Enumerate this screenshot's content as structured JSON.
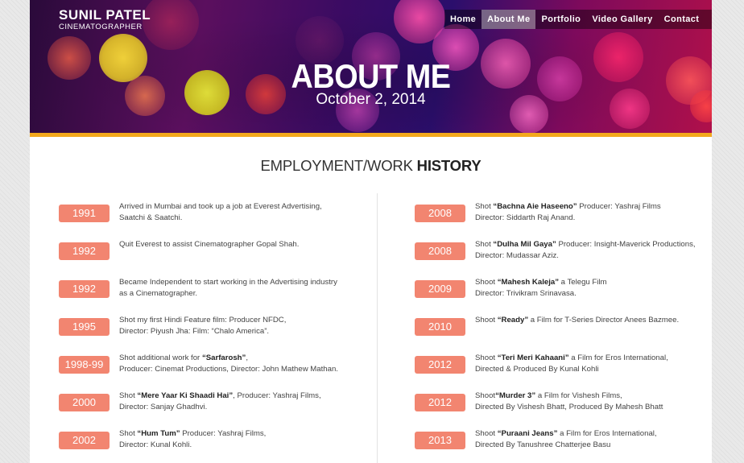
{
  "brand": {
    "name": "SUNIL PATEL",
    "subtitle": "CINEMATOGRAPHER"
  },
  "nav": {
    "items": [
      {
        "label": "Home",
        "active": false
      },
      {
        "label": "About Me",
        "active": true
      },
      {
        "label": "Portfolio",
        "active": false
      },
      {
        "label": "Video Gallery",
        "active": false
      },
      {
        "label": "Contact",
        "active": false
      }
    ]
  },
  "hero": {
    "title": "ABOUT ME",
    "date": "October 2, 2014"
  },
  "colors": {
    "accent_bar": "#f3a81c",
    "year_badge": "#f28570"
  },
  "section": {
    "title_light": "EMPLOYMENT/WORK ",
    "title_bold": "HISTORY"
  },
  "history_left": [
    {
      "year": "1991",
      "lines": [
        [
          {
            "t": "Arrived in Mumbai and took up a job at Everest Advertising,"
          }
        ],
        [
          {
            "t": "Saatchi & Saatchi."
          }
        ]
      ]
    },
    {
      "year": "1992",
      "lines": [
        [
          {
            "t": "Quit Everest to assist Cinematographer Gopal Shah."
          }
        ]
      ]
    },
    {
      "year": "1992",
      "lines": [
        [
          {
            "t": "Became Independent to start working in the Advertising industry"
          }
        ],
        [
          {
            "t": "as a Cinematographer."
          }
        ]
      ]
    },
    {
      "year": "1995",
      "lines": [
        [
          {
            "t": "Shot my first Hindi Feature film: Producer NFDC,"
          }
        ],
        [
          {
            "t": "Director: Piyush Jha: Film: “Chalo America”."
          }
        ]
      ]
    },
    {
      "year": "1998-99",
      "lines": [
        [
          {
            "t": "Shot additional work for "
          },
          {
            "t": "“Sarfarosh”",
            "b": true
          },
          {
            "t": ","
          }
        ],
        [
          {
            "t": "Producer: Cinemat Productions, Director: John Mathew Mathan."
          }
        ]
      ]
    },
    {
      "year": "2000",
      "lines": [
        [
          {
            "t": "Shot "
          },
          {
            "t": "“Mere Yaar Ki Shaadi Hai”",
            "b": true
          },
          {
            "t": ", Producer: Yashraj Films,"
          }
        ],
        [
          {
            "t": "Director: Sanjay Ghadhvi."
          }
        ]
      ]
    },
    {
      "year": "2002",
      "lines": [
        [
          {
            "t": "Shot "
          },
          {
            "t": "“Hum Tum”",
            "b": true
          },
          {
            "t": " Producer: Yashraj Films,"
          }
        ],
        [
          {
            "t": "Director: Kunal Kohli."
          }
        ]
      ]
    }
  ],
  "history_right": [
    {
      "year": "2008",
      "lines": [
        [
          {
            "t": "Shot "
          },
          {
            "t": "“Bachna Aie Haseeno”",
            "b": true
          },
          {
            "t": " Producer: Yashraj Films"
          }
        ],
        [
          {
            "t": "Director: Siddarth Raj Anand."
          }
        ]
      ]
    },
    {
      "year": "2008",
      "lines": [
        [
          {
            "t": "Shot "
          },
          {
            "t": "“Dulha Mil Gaya”",
            "b": true
          },
          {
            "t": " Producer: Insight-Maverick Productions,"
          }
        ],
        [
          {
            "t": "Director: Mudassar Aziz."
          }
        ]
      ]
    },
    {
      "year": "2009",
      "lines": [
        [
          {
            "t": "Shoot "
          },
          {
            "t": "“Mahesh Kaleja”",
            "b": true
          },
          {
            "t": " a Telegu Film"
          }
        ],
        [
          {
            "t": "Director: Trivikram Srinavasa."
          }
        ]
      ]
    },
    {
      "year": "2010",
      "lines": [
        [
          {
            "t": "Shoot "
          },
          {
            "t": "“Ready”",
            "b": true
          },
          {
            "t": " a Film for T-Series Director Anees Bazmee."
          }
        ]
      ]
    },
    {
      "year": "2012",
      "lines": [
        [
          {
            "t": "Shoot "
          },
          {
            "t": "“Teri Meri Kahaani”",
            "b": true
          },
          {
            "t": " a Film for Eros International,"
          }
        ],
        [
          {
            "t": "Directed & Produced By Kunal Kohli"
          }
        ]
      ]
    },
    {
      "year": "2012",
      "lines": [
        [
          {
            "t": "Shoot"
          },
          {
            "t": "“Murder 3”",
            "b": true
          },
          {
            "t": " a Film for Vishesh Films,"
          }
        ],
        [
          {
            "t": "Directed By Vishesh Bhatt, Produced By Mahesh Bhatt"
          }
        ]
      ]
    },
    {
      "year": "2013",
      "lines": [
        [
          {
            "t": "Shoot "
          },
          {
            "t": "“Puraani Jeans”",
            "b": true
          },
          {
            "t": " a Film for Eros International,"
          }
        ],
        [
          {
            "t": "Directed By Tanushree Chatterjee Basu"
          }
        ]
      ]
    }
  ]
}
